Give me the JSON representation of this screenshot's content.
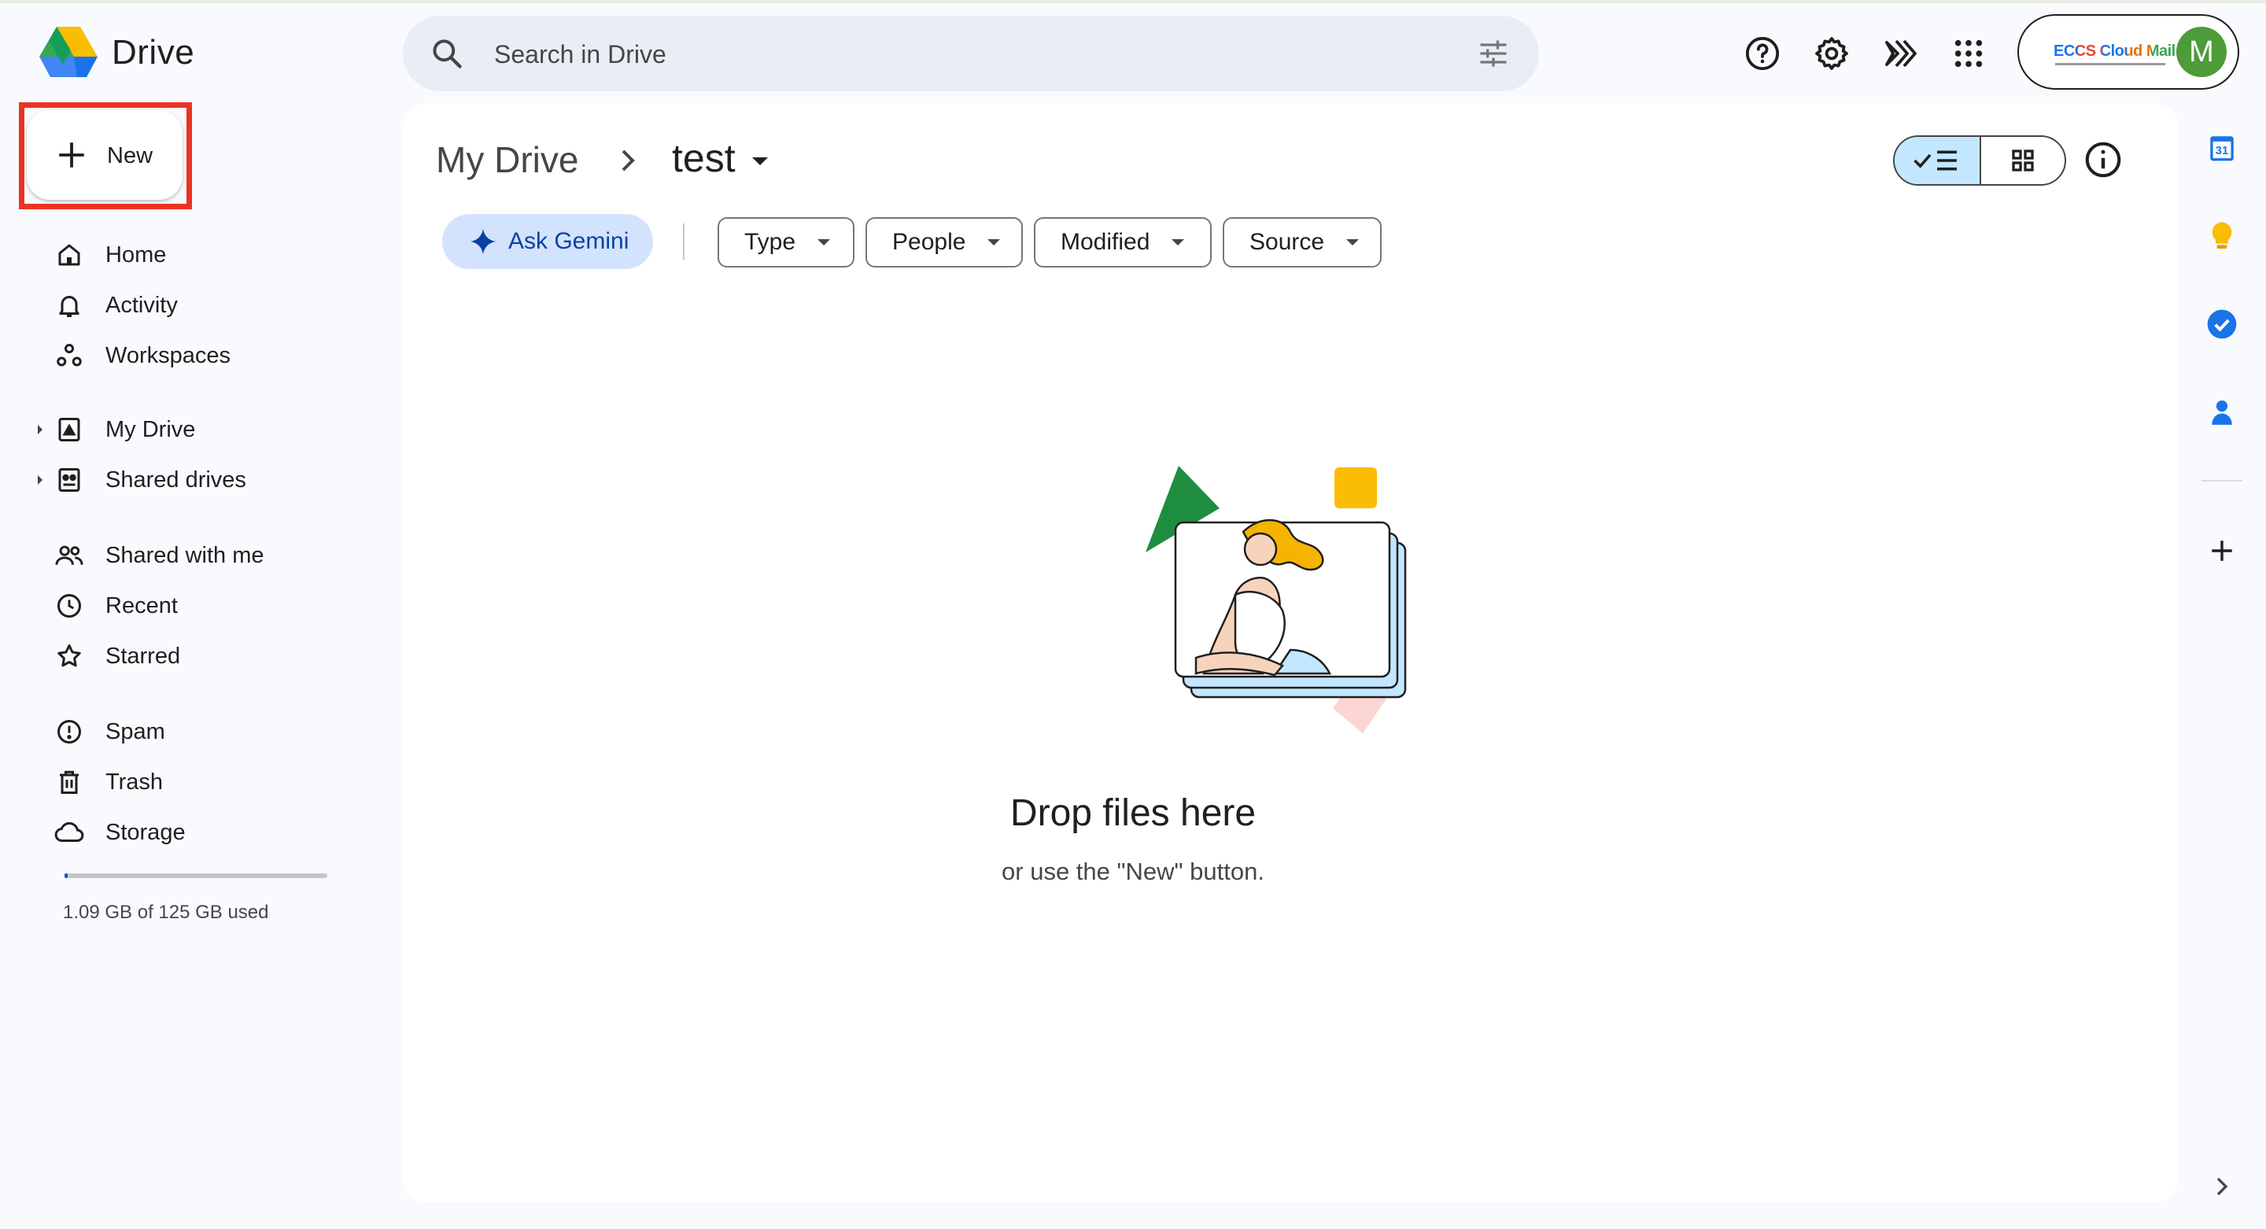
{
  "app": {
    "name": "Drive"
  },
  "search": {
    "placeholder": "Search in Drive"
  },
  "account": {
    "org_logo_text": "ECCS Cloud Mail",
    "avatar_letter": "M",
    "avatar_color": "#4d9b39"
  },
  "new_button": {
    "label": "New"
  },
  "nav": {
    "items": [
      {
        "label": "Home",
        "icon": "home-icon"
      },
      {
        "label": "Activity",
        "icon": "bell-icon"
      },
      {
        "label": "Workspaces",
        "icon": "workspaces-icon"
      },
      {
        "label": "My Drive",
        "icon": "my-drive-icon"
      },
      {
        "label": "Shared drives",
        "icon": "shared-drives-icon"
      },
      {
        "label": "Shared with me",
        "icon": "people-icon"
      },
      {
        "label": "Recent",
        "icon": "clock-icon"
      },
      {
        "label": "Starred",
        "icon": "star-icon"
      },
      {
        "label": "Spam",
        "icon": "spam-icon"
      },
      {
        "label": "Trash",
        "icon": "trash-icon"
      },
      {
        "label": "Storage",
        "icon": "cloud-icon"
      }
    ]
  },
  "storage": {
    "used_text": "1.09 GB of 125 GB used",
    "used_fraction": 0.0087
  },
  "breadcrumb": {
    "root": "My Drive",
    "current": "test"
  },
  "filters": {
    "gemini_label": "Ask Gemini",
    "chips": [
      "Type",
      "People",
      "Modified",
      "Source"
    ]
  },
  "empty_state": {
    "title": "Drop files here",
    "subtitle": "or use the \"New\" button."
  },
  "colors": {
    "highlight": "#ea3323",
    "accent": "#0b57d0",
    "selected_toggle": "#c2e7ff"
  }
}
